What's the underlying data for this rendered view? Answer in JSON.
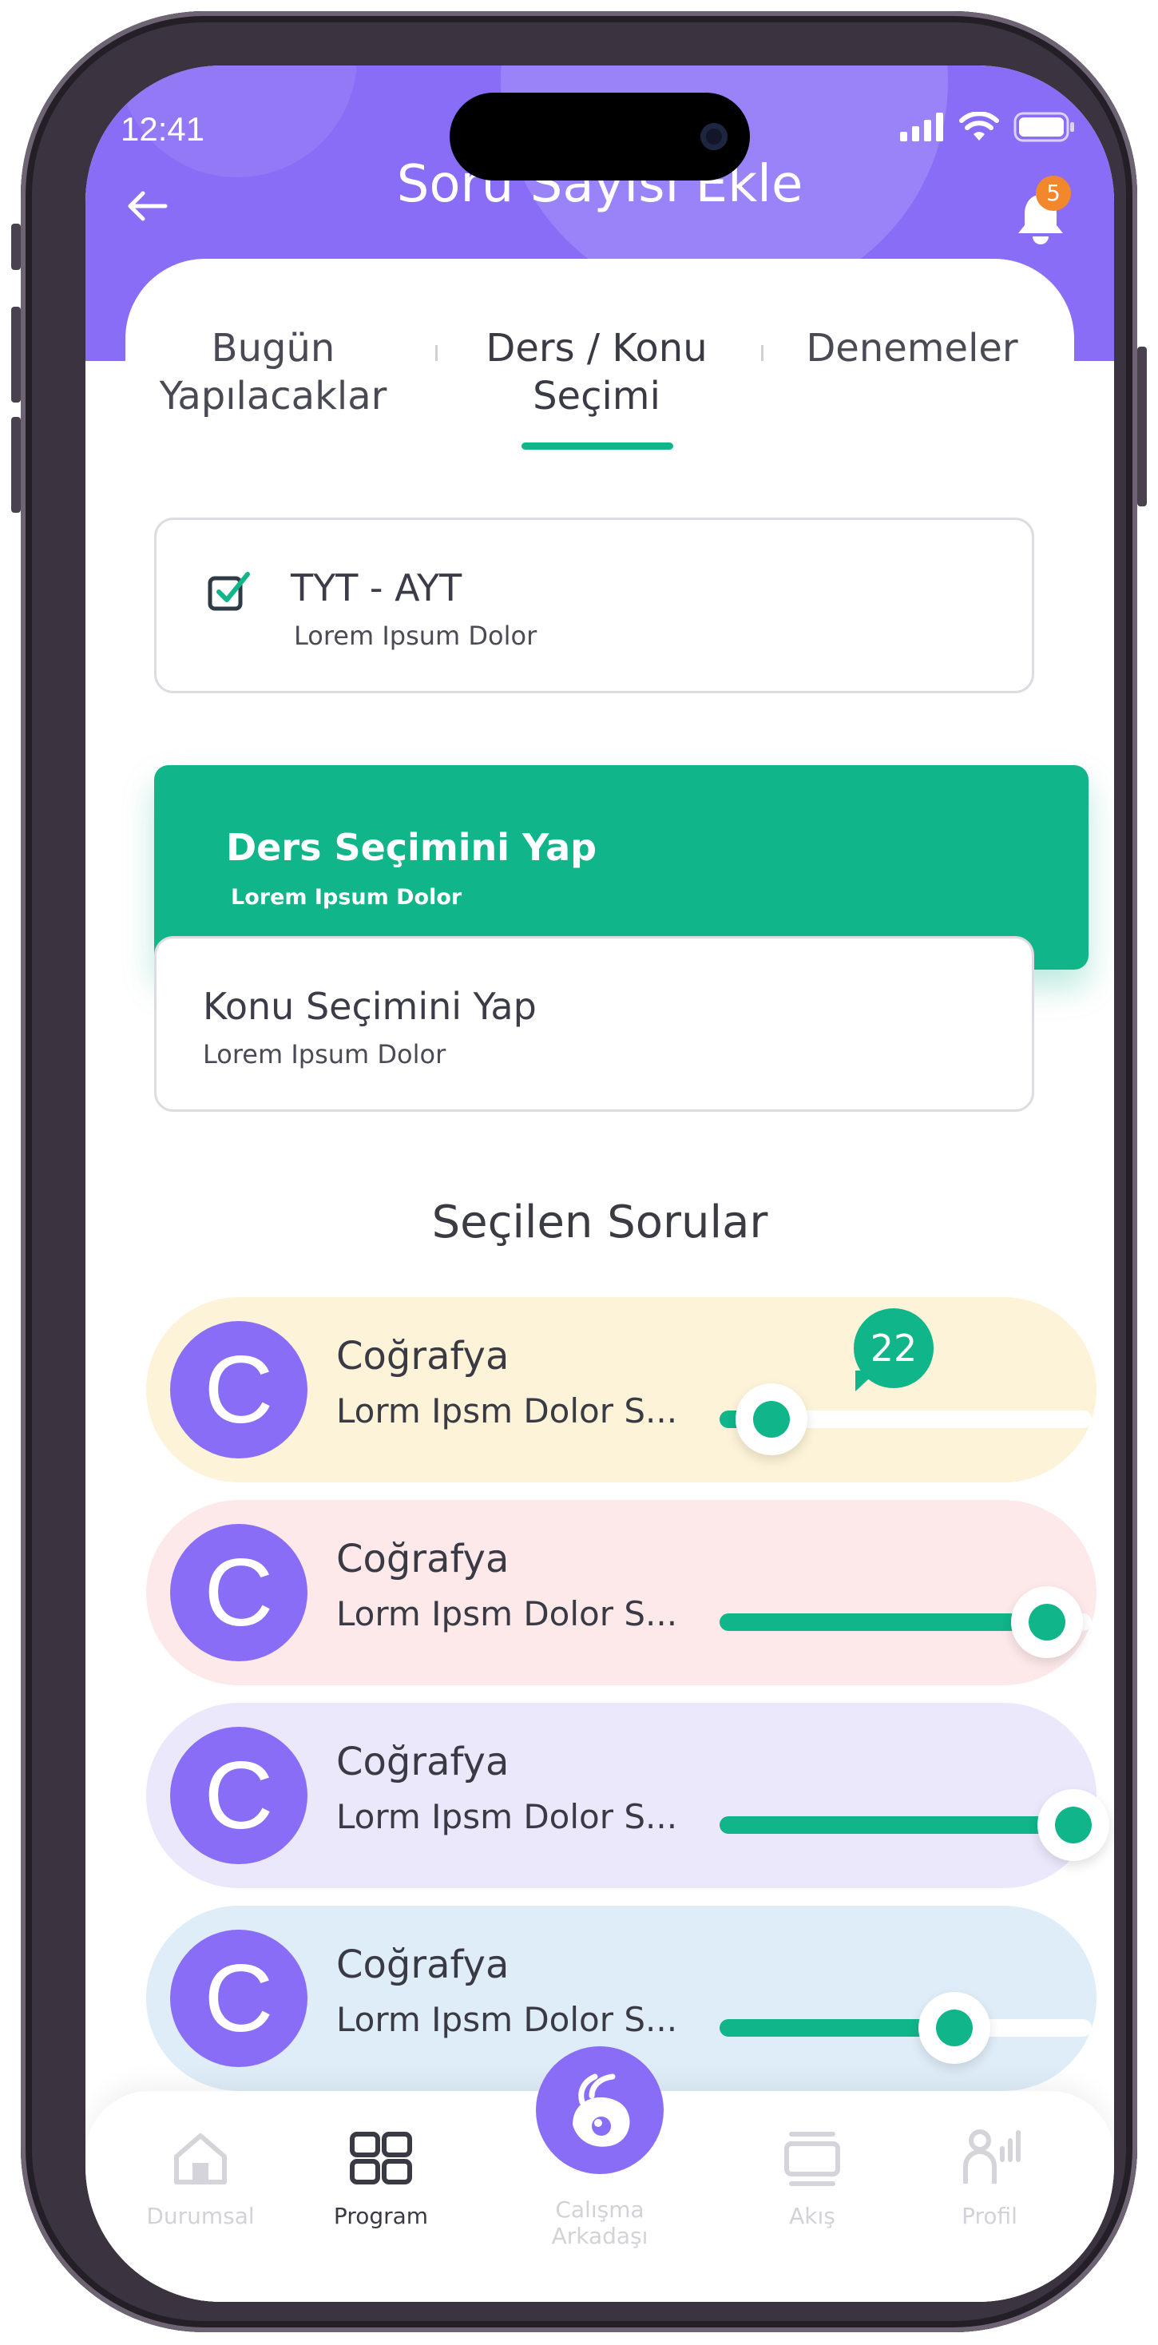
{
  "status_bar": {
    "time": "12:41"
  },
  "header": {
    "title": "Soru Sayısı Ekle",
    "notification_count": "5"
  },
  "tabs": [
    {
      "label": "Bugün Yapılacaklar"
    },
    {
      "label": "Ders / Konu Seçimi",
      "active": true
    },
    {
      "label": "Denemeler"
    }
  ],
  "options": {
    "tyt_ayt": {
      "title": "TYT - AYT",
      "subtitle": "Lorem Ipsum Dolor",
      "checked": true
    },
    "ders": {
      "title": "Ders Seçimini Yap",
      "subtitle": "Lorem Ipsum Dolor"
    },
    "konu": {
      "title": "Konu Seçimini Yap",
      "subtitle": "Lorem Ipsum Dolor"
    }
  },
  "section": {
    "title": "Seçilen Sorular"
  },
  "questions": [
    {
      "avatar_letter": "C",
      "title": "Coğrafya",
      "subtitle": "Lorm Ipsm Dolor S...",
      "slider_fraction": 0.14,
      "tooltip_value": "22",
      "bg_color": "#fdf3d8"
    },
    {
      "avatar_letter": "C",
      "title": "Coğrafya",
      "subtitle": "Lorm Ipsm Dolor S...",
      "slider_fraction": 0.88,
      "bg_color": "#fde9ea"
    },
    {
      "avatar_letter": "C",
      "title": "Coğrafya",
      "subtitle": "Lorm Ipsm Dolor S...",
      "slider_fraction": 0.95,
      "bg_color": "#ece8fc"
    },
    {
      "avatar_letter": "C",
      "title": "Coğrafya",
      "subtitle": "Lorm Ipsm Dolor S...",
      "slider_fraction": 0.63,
      "bg_color": "#dfedf8"
    }
  ],
  "nav": {
    "items": [
      {
        "label": "Durumsal",
        "icon": "home-icon",
        "active": false
      },
      {
        "label": "Program",
        "icon": "grid-icon",
        "active": true
      },
      {
        "label": "Calışma Arkadaşı",
        "icon": "buddy-icon",
        "active": false
      },
      {
        "label": "Akış",
        "icon": "cards-icon",
        "active": false
      },
      {
        "label": "Profil",
        "icon": "profile-icon",
        "active": false
      }
    ]
  },
  "colors": {
    "primary": "#8a6df6",
    "accent": "#10b58a",
    "badge": "#f3872b"
  }
}
